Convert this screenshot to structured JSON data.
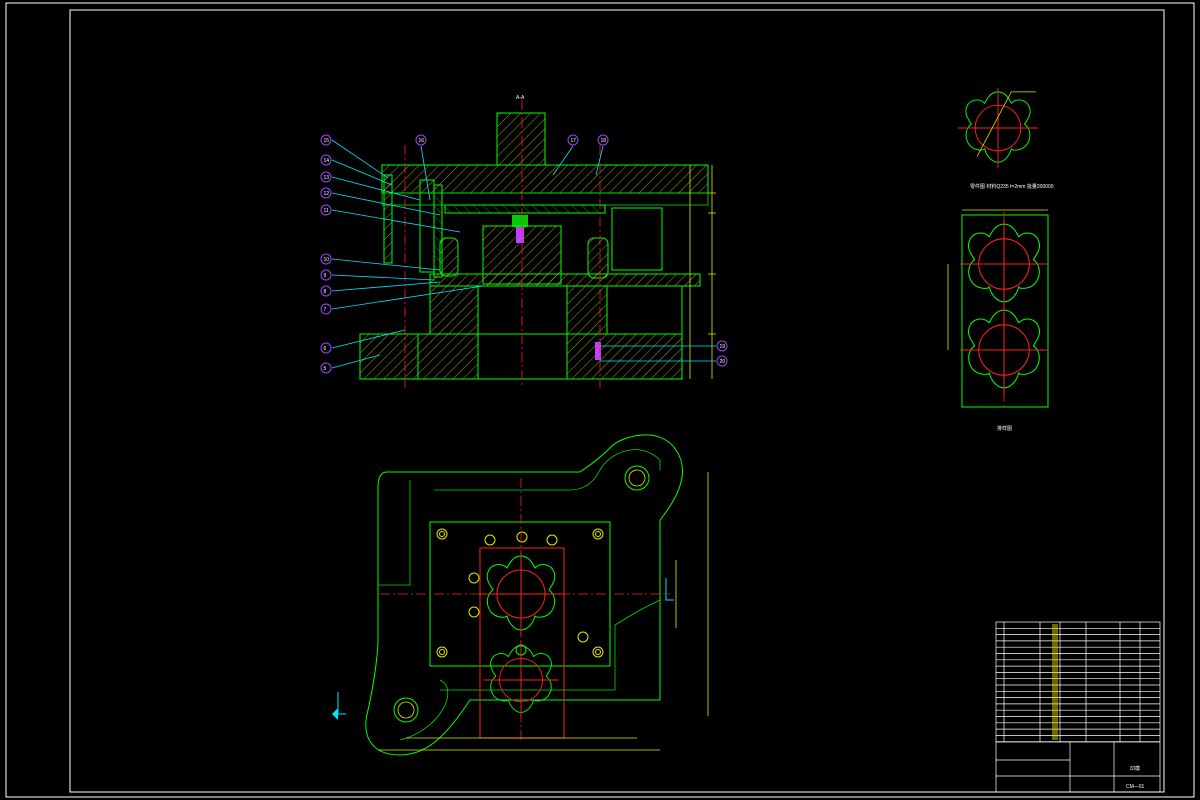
{
  "drawing": {
    "section_label": "A-A",
    "part_view_caption": "零件图 材料Q235 t=2mm 批量200000",
    "strip_caption": "排样图",
    "title_block": {
      "drawing_name": "凹模",
      "drawing_number": "CM—01"
    }
  },
  "colors": {
    "background": "#000000",
    "frame": "#ffffff",
    "outline": "#00ff00",
    "centerline": "#ff2020",
    "hatch": "#e8e800",
    "leader": "#00e5ff",
    "balloon": "#a040ff"
  },
  "balloons": {
    "left_column": [
      "15",
      "14",
      "13",
      "12",
      "11",
      "10",
      "9",
      "8",
      "7",
      "6",
      "5"
    ],
    "top_row": [
      "16",
      "17",
      "18"
    ],
    "right_column": [
      "19",
      "20"
    ]
  }
}
